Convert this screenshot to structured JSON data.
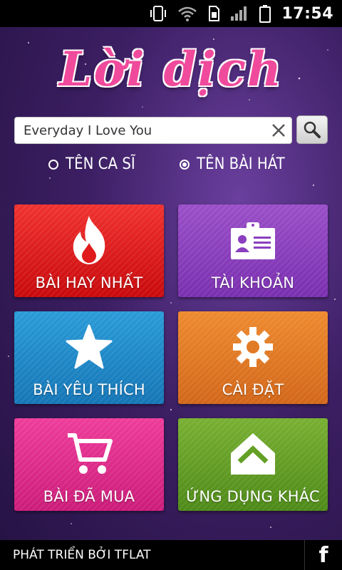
{
  "status_bar": {
    "time": "17:54",
    "icons": [
      "vibrate-icon",
      "wifi-icon",
      "sim-icon",
      "signal-icon",
      "battery-icon"
    ]
  },
  "app": {
    "logo_text": "Lời dịch"
  },
  "search": {
    "value": "Everyday I Love You",
    "clear_icon": "close-icon",
    "button_icon": "search-icon"
  },
  "search_mode": {
    "options": [
      {
        "label": "TÊN CA SĨ",
        "selected": false
      },
      {
        "label": "TÊN BÀI HÁT",
        "selected": true
      }
    ]
  },
  "tiles": [
    {
      "label": "BÀI HAY NHẤT",
      "icon": "flame-icon",
      "color": "#e01b1c"
    },
    {
      "label": "TÀI KHOẢN",
      "icon": "id-card-icon",
      "color": "#8a3fbf"
    },
    {
      "label": "BÀI YÊU THÍCH",
      "icon": "star-icon",
      "color": "#1f8ac9"
    },
    {
      "label": "CÀI ĐẶT",
      "icon": "gear-icon",
      "color": "#e07a25"
    },
    {
      "label": "BÀI ĐÃ MUA",
      "icon": "cart-icon",
      "color": "#dd2c8a"
    },
    {
      "label": "ỨNG DỤNG KHÁC",
      "icon": "home-arrow-icon",
      "color": "#63a025"
    }
  ],
  "footer": {
    "credit": "PHÁT TRIỂN BỞI TFLAT",
    "social_icon": "facebook-icon",
    "social_label": "f"
  }
}
